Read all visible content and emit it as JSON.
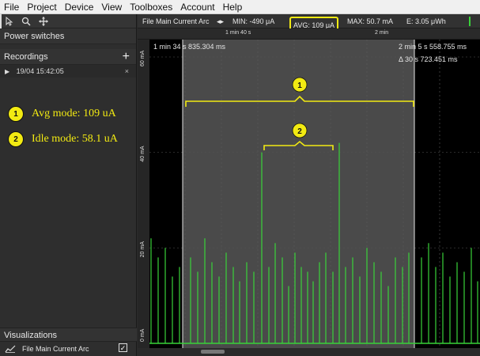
{
  "menu": [
    "File",
    "Project",
    "Device",
    "View",
    "Toolboxes",
    "Account",
    "Help"
  ],
  "left": {
    "power_switches": "Power switches",
    "recordings": "Recordings",
    "add_symbol": "+",
    "recording_item": "19/04 15:42:05",
    "remove_symbol": "×",
    "annotations": [
      {
        "num": "1",
        "text": "Avg mode: 109 uA"
      },
      {
        "num": "2",
        "text": "Idle mode: 58.1 uA"
      }
    ],
    "visualizations": "Visualizations",
    "viz_item": "File Main Current Arc",
    "viz_checked": "✓"
  },
  "header": {
    "title": "File Main Current Arc",
    "min": "MIN: -490 μA",
    "avg": "AVG: 109 μA",
    "max": "MAX: 50.7 mA",
    "energy": "E: 3.05 μWh"
  },
  "ruler": {
    "t1": "1 min 40 s",
    "t2": "2 min"
  },
  "plot": {
    "start_time": "1 min 34 s 835.304 ms",
    "end_time": "2 min 5 s 558.755 ms",
    "delta": "Δ 30 s 723.451 ms",
    "bracket1": "1",
    "bracket2": "2"
  },
  "chart_data": {
    "type": "line",
    "title": "File Main Current Arc",
    "ylabel": "",
    "y_ticks": [
      "60 mA",
      "40 mA",
      "20 mA",
      "0 mA"
    ],
    "ylim": [
      0,
      60
    ],
    "x_ticks": [
      "1 min 40 s",
      "2 min"
    ],
    "series": [
      {
        "name": "File Main Current Arc",
        "color": "#39d239"
      }
    ]
  },
  "colors": {
    "accent": "#f2ea12",
    "trace": "#39d239"
  }
}
